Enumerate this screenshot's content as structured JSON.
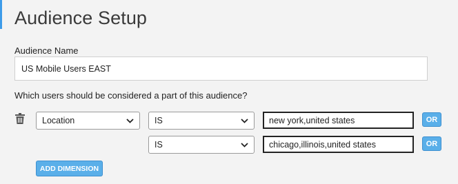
{
  "page": {
    "title": "Audience Setup"
  },
  "audience_name": {
    "label": "Audience Name",
    "value": "US Mobile Users EAST"
  },
  "question": "Which users should be considered a part of this audience?",
  "dimension": {
    "selected": "Location"
  },
  "conditions": [
    {
      "operator": "IS",
      "value": "new york,united states",
      "or_label": "OR"
    },
    {
      "operator": "IS",
      "value": "chicago,illinois,united states",
      "or_label": "OR"
    }
  ],
  "add_dimension_label": "ADD DIMENSION",
  "colors": {
    "accent": "#3d9be9",
    "button": "#5aafe9",
    "background": "#f3f3f3"
  },
  "icons": {
    "delete": "trash-icon",
    "dropdown": "chevron-down-icon"
  }
}
